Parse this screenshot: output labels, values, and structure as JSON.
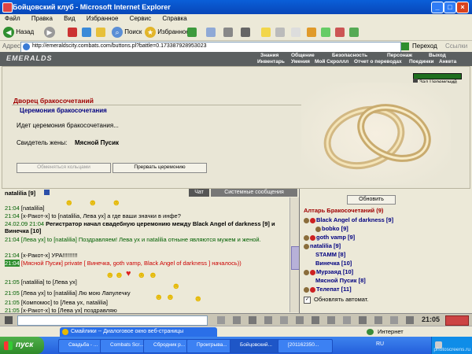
{
  "window": {
    "title": "Бойцовский клуб - Microsoft Internet Explorer"
  },
  "menu": [
    "Файл",
    "Правка",
    "Вид",
    "Избранное",
    "Сервис",
    "Справка"
  ],
  "toolbar": {
    "back": "Назад",
    "search": "Поиск",
    "favorites": "Избранное"
  },
  "address": {
    "label": "Адрес:",
    "url": "http://emeraldscity.combats.com/buttons.pl?battle=0.173387928953023",
    "go": "Переход",
    "links": "Ссылки"
  },
  "game_nav": {
    "logo": "EMERALDS",
    "top": [
      "Знания",
      "Общение",
      "Безопасность",
      "Персонаж",
      "Выход"
    ],
    "bottom": [
      "Инвентарь",
      "Умения",
      "Мой Скроллл",
      "Отчет о переводах",
      "Поединки",
      "Анкета"
    ]
  },
  "ceremony": {
    "button_hall": "Зал Церемоний",
    "title": "Дворец бракосочетаний",
    "tab": "Церемония бракосочетания",
    "status": "Идет церемония бракосочетания...",
    "witness_label": "Свидетель жены:",
    "witness_name": "Мясной Пусик",
    "btn_exchange": "Обменяться кольцами",
    "btn_interrupt": "Прервать церемонию"
  },
  "chat": {
    "header_user": "natalilia [9]",
    "tabs": [
      "Чат",
      "Системные сообщения"
    ],
    "lines": [
      {
        "time": "21:04",
        "text": "[natalilia]"
      },
      {
        "time": "21:04",
        "text": "[х-Ракот-х] to [natalilia, Лева ух] а где ваши значки в инфе?"
      },
      {
        "time": "24.02.09 21:04",
        "text": "Регистратор начал свадебную церемонию между Black Angel of darkness [9] и Винечка [10]"
      },
      {
        "time": "21:04",
        "text": "[Лева ух] to [natalilia] Поздравляем! Лева ух и natalilia отныне являются мужем и женой."
      },
      {
        "time": "21:04",
        "text": "[х-Ракот-х] УРА!!!!!!!!!"
      },
      {
        "time": "21:04",
        "text": "[Мясной Пусик] private [ Винечка, goth vamp, Black Angel of darkness ] началось))"
      },
      {
        "time": "21:05",
        "text": "[natalilia] to [Лева ух]"
      },
      {
        "time": "21:05",
        "text": "[Лева ух] to [natalilia] Лю мою Лапулечку"
      },
      {
        "time": "21:05",
        "text": "[Компомос] to [Лева ух, natalilia]"
      },
      {
        "time": "21:05",
        "text": "[х-Ракот-х] to [Лева ух] поздравляю"
      }
    ]
  },
  "users": {
    "refresh": "Обновить",
    "room": "Алтарь Бракосочетаний (9)",
    "list": [
      "Black Angel of darkness [9]",
      "bobko [9]",
      "goth vamp [9]",
      "natalilia [9]",
      "STAMM [8]",
      "Винечка [10]",
      "Мурзаяд [10]",
      "Мясной Пусик [8]",
      "Телепат [11]"
    ],
    "auto": "Обновлять автомат."
  },
  "clock": "21:05",
  "statusbar": {
    "zone": "Интернет"
  },
  "taskbar": {
    "start": "пуск",
    "tooltip": "Смайлики -- Диалоговое окно веб-страницы",
    "tasks": [
      "Свадьба - ...",
      "Combats Scr...",
      "Сбродник р...",
      "Проигрыва...",
      "Бойцовский...",
      "[201162350..."
    ],
    "lang": "RU",
    "watermark": "photoscreens.ru"
  },
  "colors": {
    "titlebar": "#0a5fd8",
    "accent_red": "#a00000",
    "link_blue": "#000080",
    "chat_green": "#006000"
  }
}
